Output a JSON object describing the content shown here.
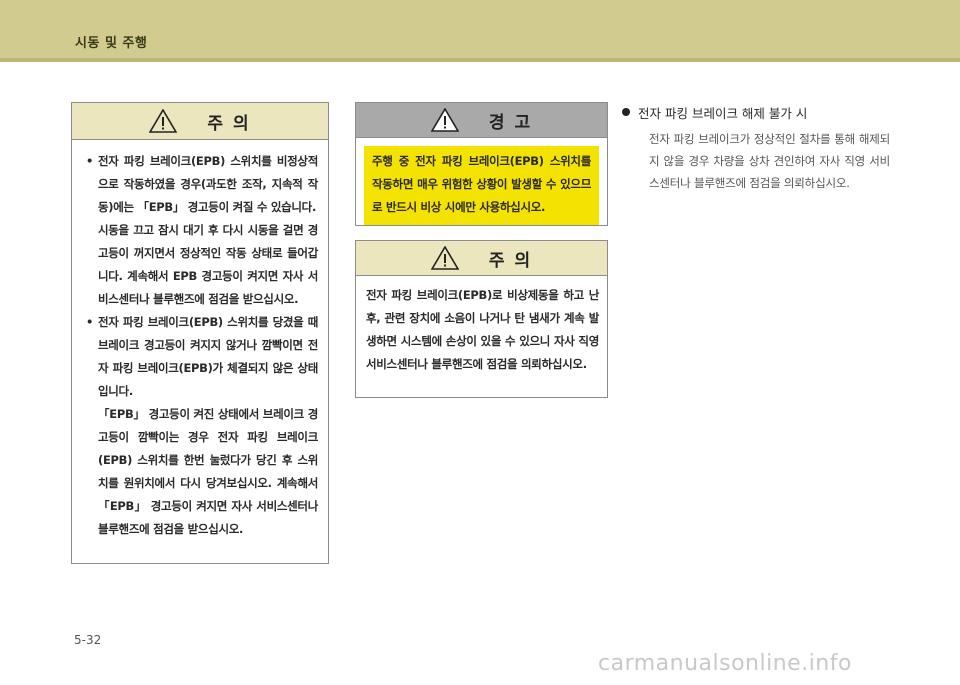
{
  "header": {
    "section_title": "시동 및 주행"
  },
  "caution_left": {
    "title": "주     의",
    "items": [
      {
        "paragraphs": [
          "전자 파킹 브레이크(EPB) 스위치를 비정상적으로 작동하였을 경우(과도한 조작, 지속적 작동)에는 「EPB」 경고등이 켜질 수 있습니다.",
          "시동을 끄고 잠시 대기 후 다시 시동을 걸면 경고등이 꺼지면서 정상적인 작동 상태로 들어갑니다. 계속해서 EPB 경고등이 켜지면 자사 서비스센터나 블루핸즈에 점검을 받으십시오."
        ]
      },
      {
        "paragraphs": [
          "전자 파킹 브레이크(EPB) 스위치를 당겼을 때 브레이크 경고등이 켜지지 않거나 깜빡이면 전자 파킹 브레이크(EPB)가 체결되지 않은 상태입니다.",
          "「EPB」 경고등이 켜진 상태에서 브레이크 경고등이 깜빡이는 경우 전자 파킹 브레이크(EPB) 스위치를 한번 눌렀다가 당긴 후 스위치를 원위치에서 다시 당겨보십시오. 계속해서 「EPB」 경고등이 켜지면 자사 서비스센터나 블루핸즈에 점검을 받으십시오."
        ]
      }
    ]
  },
  "warning": {
    "title": "경     고",
    "text": "주행 중 전자 파킹 브레이크(EPB) 스위치를 작동하면 매우 위험한 상황이 발생할 수 있으므로 반드시 비상 시에만 사용하십시오."
  },
  "caution_mid": {
    "title": "주     의",
    "text": "전자 파킹 브레이크(EPB)로 비상제동을 하고 난 후, 관련 장치에 소음이 나거나 탄 냄새가 계속 발생하면 시스템에 손상이 있을 수 있으니 자사 직영 서비스센터나 블루핸즈에 점검을 의뢰하십시오."
  },
  "right_section": {
    "heading": "전자 파킹 브레이크 해제 불가 시",
    "body": "전자 파킹 브레이크가 정상적인 절차를 통해 해제되지 않을 경우 차량을 상차 견인하여 자사 직영 서비스센터나 블루핸즈에 점검을 의뢰하십시오."
  },
  "footer": {
    "page_number": "5-32",
    "watermark": "carmanualsonline.info"
  },
  "colors": {
    "header_band": "#d1cb8f",
    "caution_head": "#ece6be",
    "warning_head": "#a9a9a9",
    "warning_body": "#f4e300"
  },
  "icons": {
    "warning_triangle": "warning-triangle-icon"
  }
}
